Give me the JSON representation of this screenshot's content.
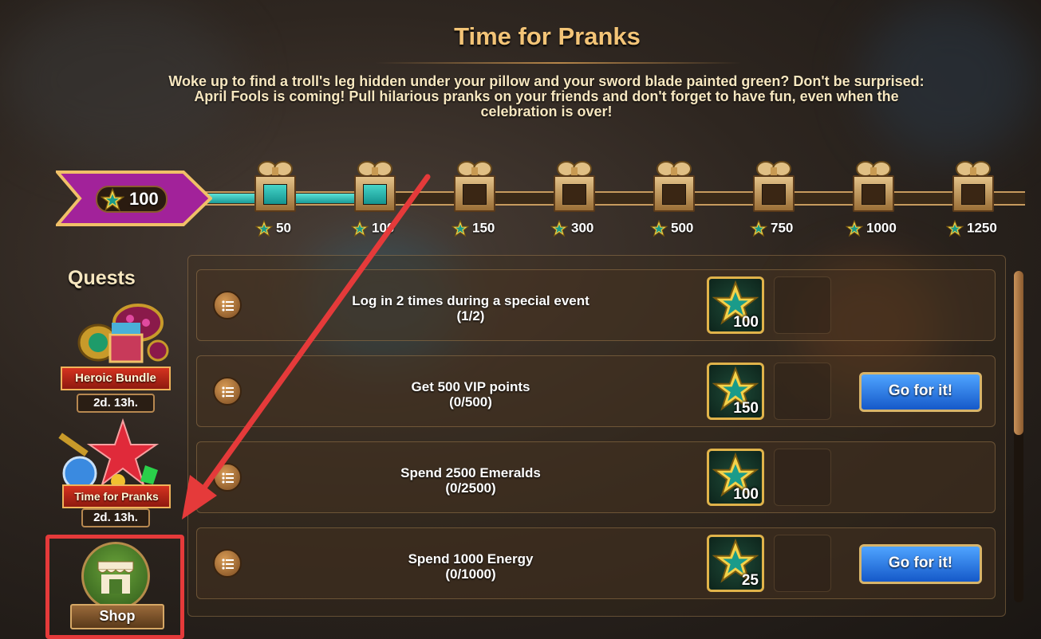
{
  "event": {
    "title": "Time for Pranks",
    "description": "Woke up to find a troll's leg hidden under your pillow and your sword blade painted green? Don't be surprised: April Fools is coming! Pull hilarious pranks on your friends and don't forget to have fun, even when the celebration is over!",
    "points": "100",
    "progress_fraction": 0.2
  },
  "milestones": [
    {
      "value": "50",
      "claimed": true
    },
    {
      "value": "100",
      "claimed": true
    },
    {
      "value": "150",
      "claimed": false
    },
    {
      "value": "300",
      "claimed": false
    },
    {
      "value": "500",
      "claimed": false
    },
    {
      "value": "750",
      "claimed": false
    },
    {
      "value": "1000",
      "claimed": false
    },
    {
      "value": "1250",
      "claimed": false
    }
  ],
  "sidebar": {
    "quests_label": "Quests",
    "items": [
      {
        "label": "Heroic Bundle",
        "timer": "2d. 13h.",
        "icon": "treasure-chest-icon"
      },
      {
        "label": "Time for Pranks",
        "timer": "2d. 13h.",
        "icon": "star-gems-icon"
      }
    ],
    "shop_label": "Shop"
  },
  "quests": [
    {
      "title": "Log in 2 times during a special event",
      "progress": "(1/2)",
      "reward": "100",
      "has_button": false
    },
    {
      "title": "Get 500 VIP points",
      "progress": "(0/500)",
      "reward": "150",
      "has_button": true
    },
    {
      "title": "Spend 2500 Emeralds",
      "progress": "(0/2500)",
      "reward": "100",
      "has_button": false
    },
    {
      "title": "Spend 1000 Energy",
      "progress": "(0/1000)",
      "reward": "25",
      "has_button": true
    }
  ],
  "go_button_label": "Go for it!",
  "colors": {
    "accent": "#f3c477",
    "annotation": "#e53a3a",
    "button": "#2a7be6"
  }
}
